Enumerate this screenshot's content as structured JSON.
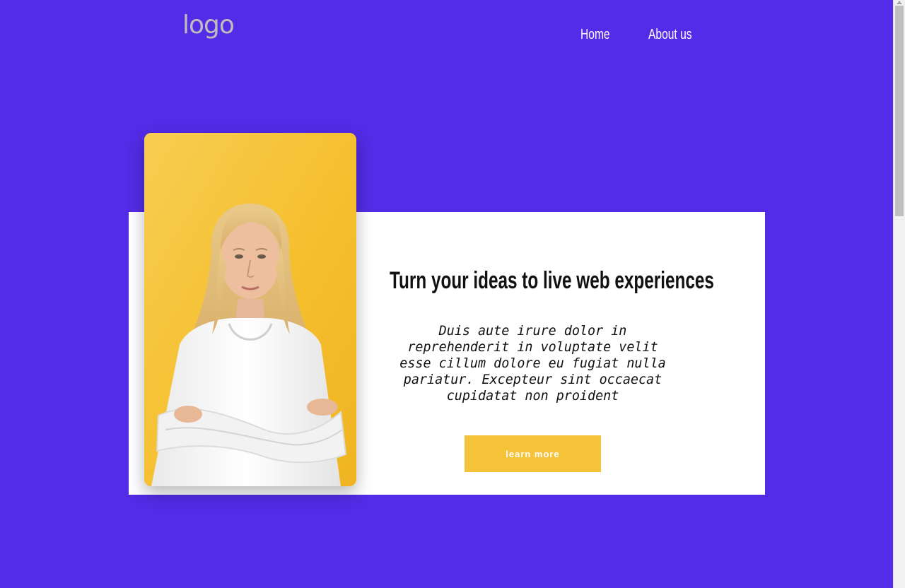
{
  "header": {
    "logo_text": "logo",
    "nav": [
      {
        "label": "Home"
      },
      {
        "label": "About us"
      }
    ]
  },
  "hero": {
    "image_alt": "",
    "headline": "Turn your ideas to live web experiences",
    "body": "Duis aute irure dolor in reprehenderit in voluptate velit esse cillum dolore eu fugiat nulla pariatur. Excepteur sint occaecat cupidatat non proident",
    "cta_label": "learn more"
  },
  "colors": {
    "background": "#522ce6",
    "card": "#ffffff",
    "accent": "#f4c33a",
    "logo": "#bdbdbd"
  }
}
